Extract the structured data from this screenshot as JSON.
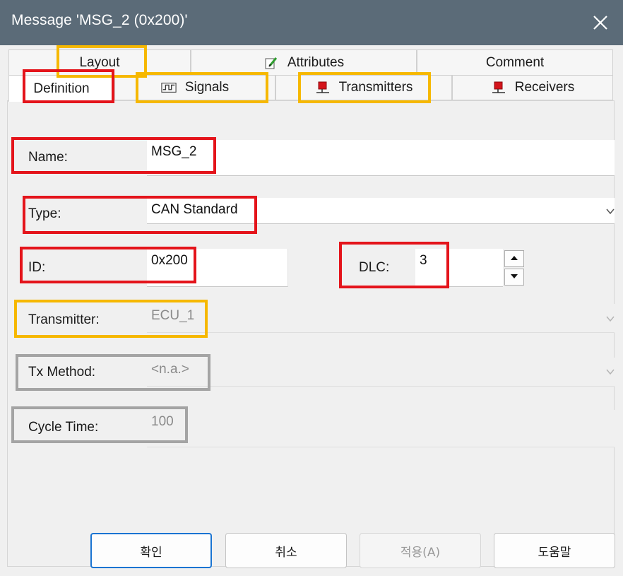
{
  "window": {
    "title": "Message 'MSG_2 (0x200)'"
  },
  "tabs": {
    "row1": [
      {
        "label": "Layout",
        "icon": ""
      },
      {
        "label": "Attributes",
        "icon": "attributes-pencil-icon"
      },
      {
        "label": "Comment",
        "icon": ""
      }
    ],
    "row2": [
      {
        "label": "Definition",
        "icon": "",
        "active": true
      },
      {
        "label": "Signals",
        "icon": "signals-waveform-icon"
      },
      {
        "label": "Transmitters",
        "icon": "node-flag-icon"
      },
      {
        "label": "Receivers",
        "icon": "node-flag-icon"
      }
    ]
  },
  "form": {
    "name": {
      "label": "Name:",
      "value": "MSG_2"
    },
    "type": {
      "label": "Type:",
      "value": "CAN Standard"
    },
    "id": {
      "label": "ID:",
      "value": "0x200"
    },
    "dlc": {
      "label": "DLC:",
      "value": "3"
    },
    "transmitter": {
      "label": "Transmitter:",
      "value": "ECU_1"
    },
    "tx_method": {
      "label": "Tx Method:",
      "value": "<n.a.>"
    },
    "cycle_time": {
      "label": "Cycle Time:",
      "value": "100"
    }
  },
  "buttons": {
    "ok": "확인",
    "cancel": "취소",
    "apply": "적용(A)",
    "help": "도움말"
  },
  "colors": {
    "titlebar": "#5b6b78",
    "highlight_red": "#e4141b",
    "highlight_orange": "#f6b800",
    "highlight_gray": "#a4a4a4",
    "default_button_border": "#1a74d2"
  }
}
